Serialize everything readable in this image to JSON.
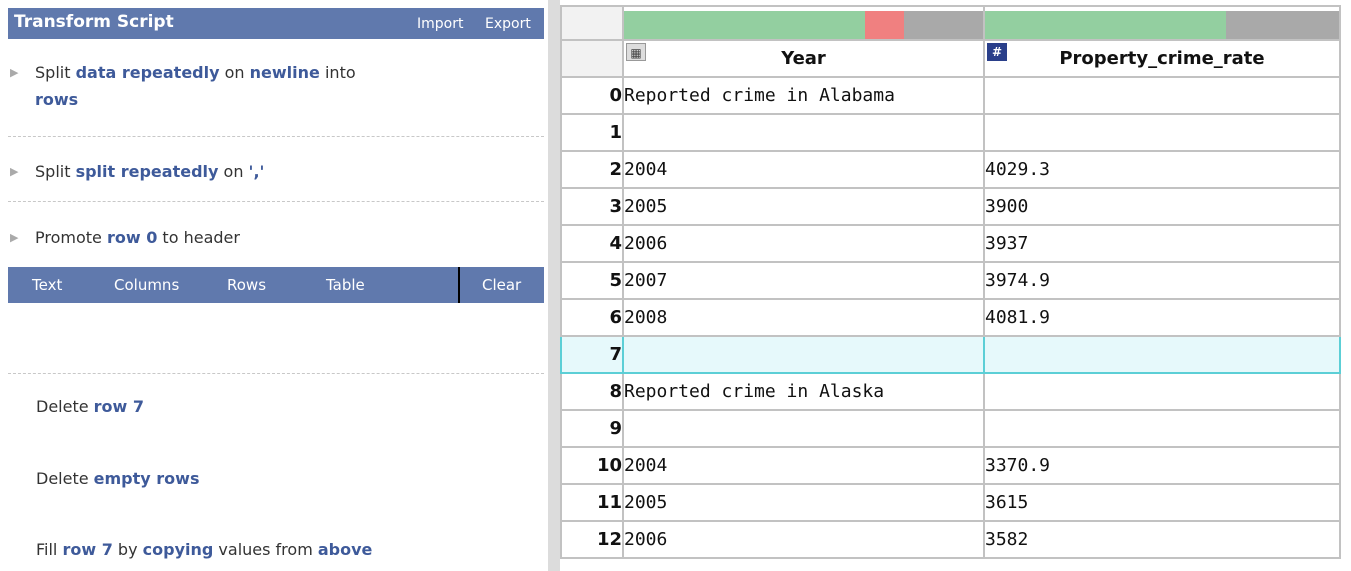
{
  "sidebar": {
    "title": "Transform Script",
    "import_label": "Import",
    "export_label": "Export",
    "steps": [
      {
        "parts": [
          "Split ",
          "data repeatedly",
          " on ",
          "newline",
          " into "
        ],
        "line2": "rows"
      },
      {
        "parts": [
          "Split ",
          "split repeatedly",
          " on ",
          "','"
        ]
      },
      {
        "parts": [
          "Promote ",
          "row 0",
          " to header"
        ]
      }
    ],
    "menu": [
      "Text",
      "Columns",
      "Rows",
      "Table",
      "Clear"
    ],
    "suggestions": [
      {
        "parts": [
          "Delete ",
          "row 7"
        ]
      },
      {
        "parts": [
          "Delete ",
          "empty rows"
        ]
      },
      {
        "parts": [
          "Fill ",
          "row 7",
          " by ",
          "copying",
          " values from ",
          "above"
        ]
      }
    ]
  },
  "grid": {
    "columns": [
      {
        "name": "Year",
        "type_icon": "calendar-icon"
      },
      {
        "name": "Property_crime_rate",
        "type_icon": "number-icon"
      }
    ],
    "quality": [
      {
        "valid": 0.67,
        "error": 0.11,
        "missing": 0.22
      },
      {
        "valid": 0.68,
        "error": 0.0,
        "missing": 0.32
      }
    ],
    "colors": {
      "valid": "#93cfa0",
      "error": "#f08080",
      "missing": "#a9a9a9",
      "selected_bg": "#e6f9fb",
      "selected_border": "#5ccfd6"
    },
    "selected_row": 7,
    "rows": [
      {
        "idx": "0",
        "year": "Reported crime in Alabama",
        "prop": ""
      },
      {
        "idx": "1",
        "year": "",
        "prop": ""
      },
      {
        "idx": "2",
        "year": "2004",
        "prop": "4029.3"
      },
      {
        "idx": "3",
        "year": "2005",
        "prop": "3900"
      },
      {
        "idx": "4",
        "year": "2006",
        "prop": "3937"
      },
      {
        "idx": "5",
        "year": "2007",
        "prop": "3974.9"
      },
      {
        "idx": "6",
        "year": "2008",
        "prop": "4081.9"
      },
      {
        "idx": "7",
        "year": "",
        "prop": ""
      },
      {
        "idx": "8",
        "year": "Reported crime in Alaska",
        "prop": ""
      },
      {
        "idx": "9",
        "year": "",
        "prop": ""
      },
      {
        "idx": "10",
        "year": "2004",
        "prop": "3370.9"
      },
      {
        "idx": "11",
        "year": "2005",
        "prop": "3615"
      },
      {
        "idx": "12",
        "year": "2006",
        "prop": "3582"
      }
    ]
  }
}
